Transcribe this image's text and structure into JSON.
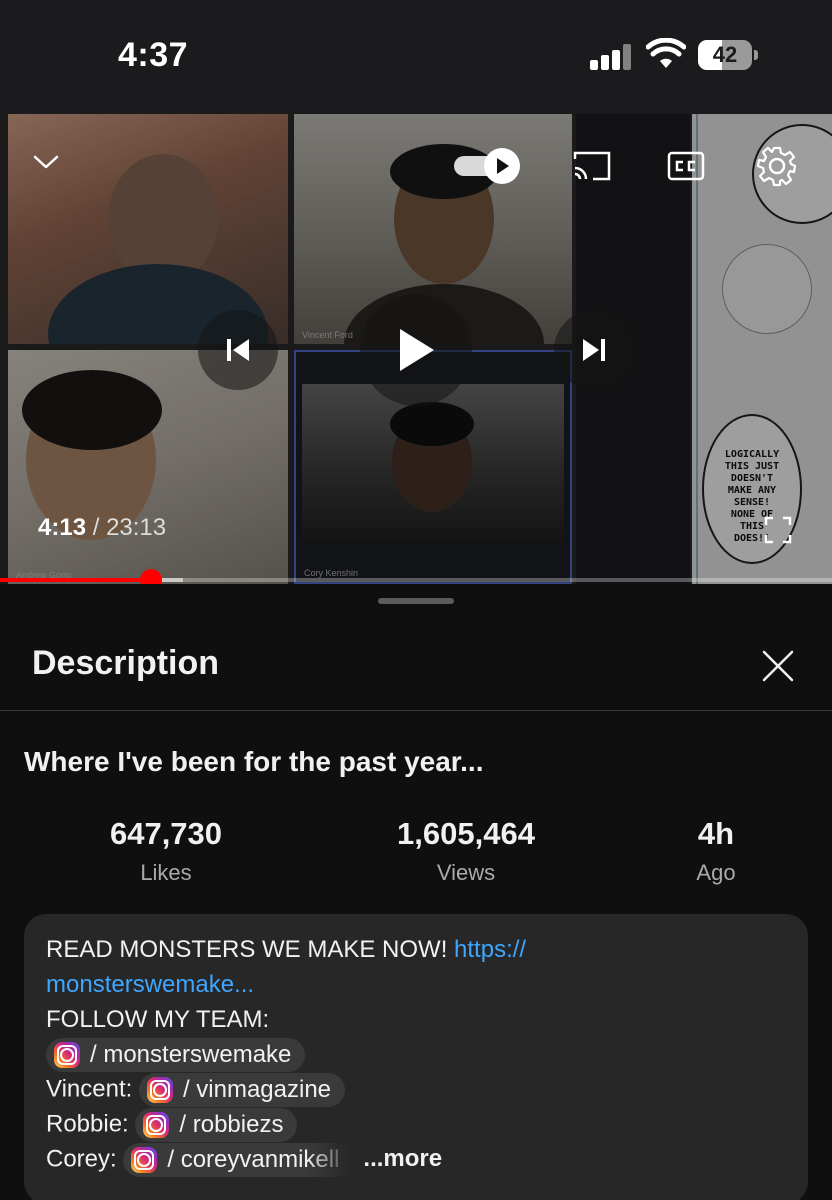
{
  "status_bar": {
    "time": "4:37",
    "battery": "42",
    "icons": [
      "cellular-signal-icon",
      "wifi-icon",
      "battery-icon"
    ]
  },
  "player": {
    "participants": [
      "",
      "Vincent Ford",
      "Andrew Gong",
      "Cory Kenshin"
    ],
    "current_time": "4:13",
    "separator": " / ",
    "duration": "23:13",
    "progress": {
      "played_fraction": 0.182,
      "buffered_fraction": 0.22
    },
    "comic_text": [
      "LOGICALLY",
      "THIS JUST",
      "DOESN'T",
      "MAKE ANY",
      "SENSE!",
      "NONE OF",
      "THIS",
      "DOES!!"
    ],
    "icons": [
      "chevron-down-icon",
      "autoplay-toggle-icon",
      "cast-icon",
      "closed-captions-icon",
      "settings-gear-icon",
      "previous-icon",
      "play-icon",
      "next-icon",
      "fullscreen-icon"
    ],
    "accent": "#ff0000"
  },
  "description": {
    "heading": "Description",
    "video_title": "Where I've been for the past year...",
    "stats": [
      {
        "value": "647,730",
        "label": "Likes"
      },
      {
        "value": "1,605,464",
        "label": "Views"
      },
      {
        "value": "4h",
        "label": "Ago"
      }
    ],
    "body": {
      "line1_text": "READ MONSTERS WE MAKE NOW! ",
      "line1_link": "https://",
      "line2_link": "monsterswemake...",
      "line3": "FOLLOW MY TEAM:",
      "team": [
        {
          "prefix": "",
          "handle": "/ monsterswemake"
        },
        {
          "prefix": "Vincent: ",
          "handle": "/ vinmagazine"
        },
        {
          "prefix": "Robbie: ",
          "handle": "/ robbiezs"
        },
        {
          "prefix": "Corey: ",
          "handle": "/ coreyvanmikell"
        }
      ],
      "more_label": "...more"
    },
    "link_color": "#3ea6ff"
  }
}
